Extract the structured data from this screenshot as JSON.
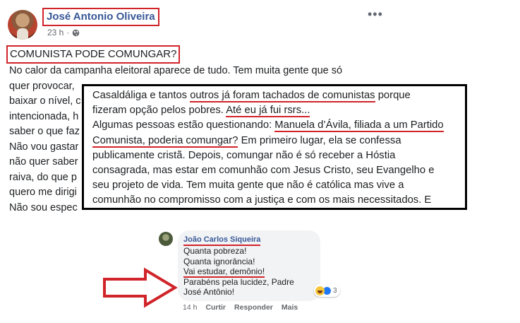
{
  "post": {
    "author": "José Antonio Oliveira",
    "time": "23 h",
    "title": "COMUNISTA PODE COMUNGAR?",
    "body_lines": [
      "No calor da campanha eleitoral aparece de tudo. Tem muita gente que só",
      "quer provocar,",
      "baixar o nível, c",
      "intencionada, h",
      "saber o que faz",
      "Não vou gastar",
      "não quer saber",
      "raiva, do que p",
      "quero me dirigi",
      "Não sou espec"
    ]
  },
  "zoom": {
    "line1_a": "Casaldáliga e tantos ",
    "line1_u": "outros já foram tachados de comunistas",
    "line1_b": " porque",
    "line2_a": "fizeram opção pelos pobres. ",
    "line2_u": "Até eu já fui rsrs...",
    "line3_a": "Algumas pessoas estão questionando: ",
    "line3_u": "Manuela d’Ávila, filiada a um Partido",
    "line4_u": "Comunista, poderia comungar?",
    "line4_b": " Em primeiro lugar, ela se confessa",
    "line5": "publicamente cristã. Depois, comungar não é só receber a Hóstia",
    "line6": "consagrada, mas estar em comunhão com Jesus Cristo, seu Evangelho e",
    "line7": "seu projeto de vida. Tem muita gente que não é católica mas vive a",
    "line8": "comunhão no compromisso com a justiça e com os mais necessitados. E"
  },
  "comment": {
    "author": "João Carlos Siqueira",
    "lines": [
      "Quanta pobreza!",
      "Quanta ignorância!"
    ],
    "underlined_line": "Vai estudar, demônio!",
    "lines_after": [
      "Parabéns pela lucidez, Padre",
      "José Antônio!"
    ],
    "reaction_count": "3",
    "time": "14 h",
    "actions": [
      "Curtir",
      "Responder",
      "Mais"
    ]
  },
  "colors": {
    "highlight_red": "#d0242a",
    "facebook_link": "#385898"
  }
}
